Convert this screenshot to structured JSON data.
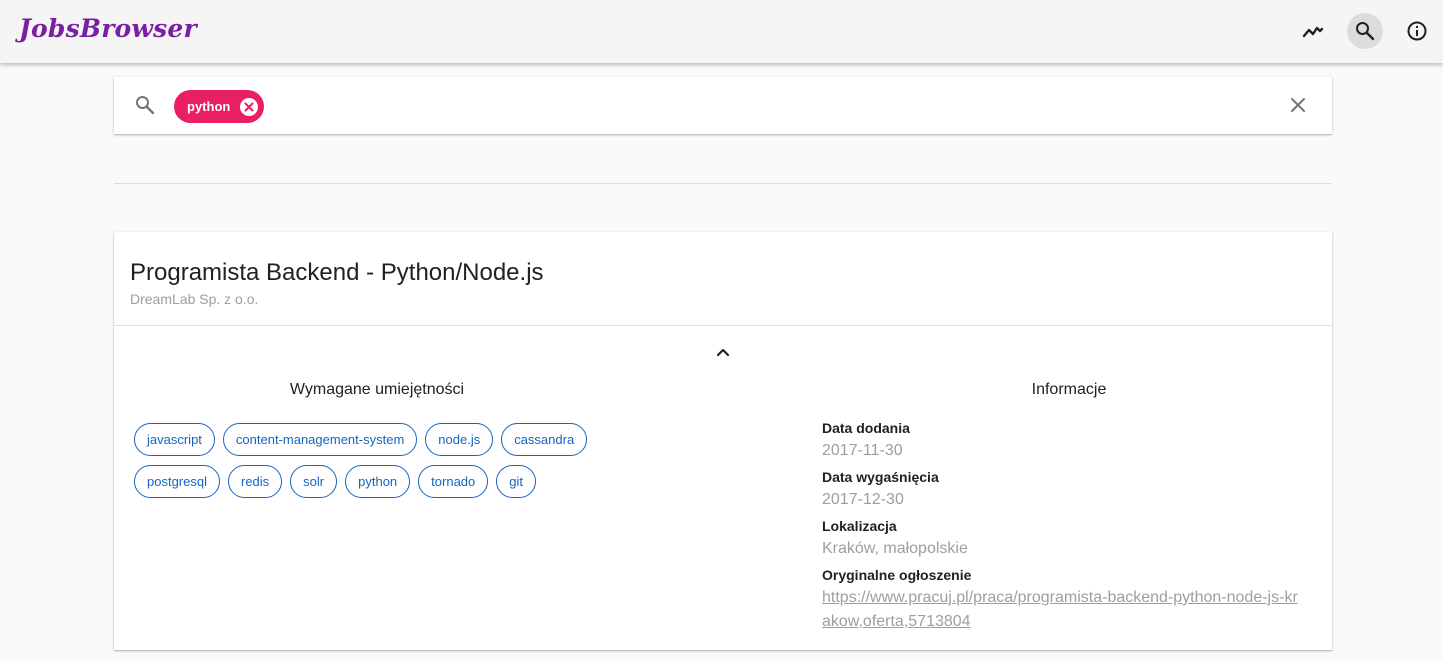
{
  "app": {
    "title": "JobsBrowser",
    "actions": [
      {
        "name": "trending-icon"
      },
      {
        "name": "search-icon"
      },
      {
        "name": "info-icon"
      }
    ]
  },
  "search": {
    "chips": [
      {
        "label": "python"
      }
    ]
  },
  "job": {
    "title": "Programista Backend - Python/Node.js",
    "company": "DreamLab Sp. z o.o.",
    "skills_heading": "Wymagane umiejętności",
    "skills": [
      "javascript",
      "content-management-system",
      "node.js",
      "cassandra",
      "postgresql",
      "redis",
      "solr",
      "python",
      "tornado",
      "git"
    ],
    "info_heading": "Informacje",
    "info": {
      "date_added_label": "Data dodania",
      "date_added": "2017-11-30",
      "expiry_label": "Data wygaśnięcia",
      "expiry": "2017-12-30",
      "location_label": "Lokalizacja",
      "location": "Kraków, małopolskie",
      "original_label": "Oryginalne ogłoszenie",
      "original_url": "https://www.pracuj.pl/praca/programista-backend-python-node-js-krakow,oferta,5713804"
    }
  },
  "colors": {
    "brand": "#7b1fa2",
    "chip": "#e91e63",
    "skill": "#1565c0"
  }
}
